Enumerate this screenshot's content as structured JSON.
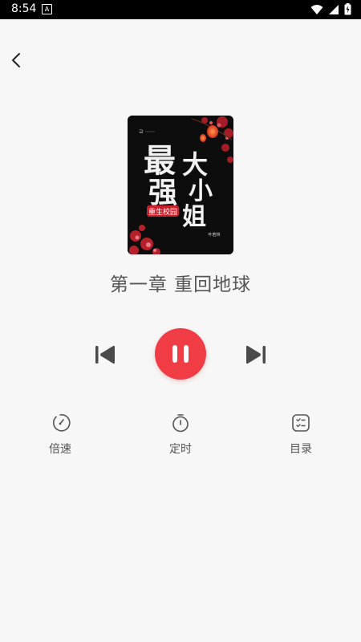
{
  "status_bar": {
    "time": "8:54",
    "notification_badge": "A",
    "icons": [
      "wifi-icon",
      "signal-icon",
      "battery-charging-icon"
    ]
  },
  "header": {
    "back_icon": "chevron-left-icon"
  },
  "cover": {
    "title_chars": [
      "最",
      "强",
      "大",
      "小",
      "姐"
    ],
    "subtitle": "重生校园",
    "author": "叶若林"
  },
  "player": {
    "chapter_title": "第一章 重回地球",
    "state": "playing",
    "accent_color": "#ef3c45"
  },
  "tools": [
    {
      "label": "倍速",
      "icon": "speed-icon"
    },
    {
      "label": "定时",
      "icon": "timer-icon"
    },
    {
      "label": "目录",
      "icon": "catalog-icon"
    }
  ]
}
